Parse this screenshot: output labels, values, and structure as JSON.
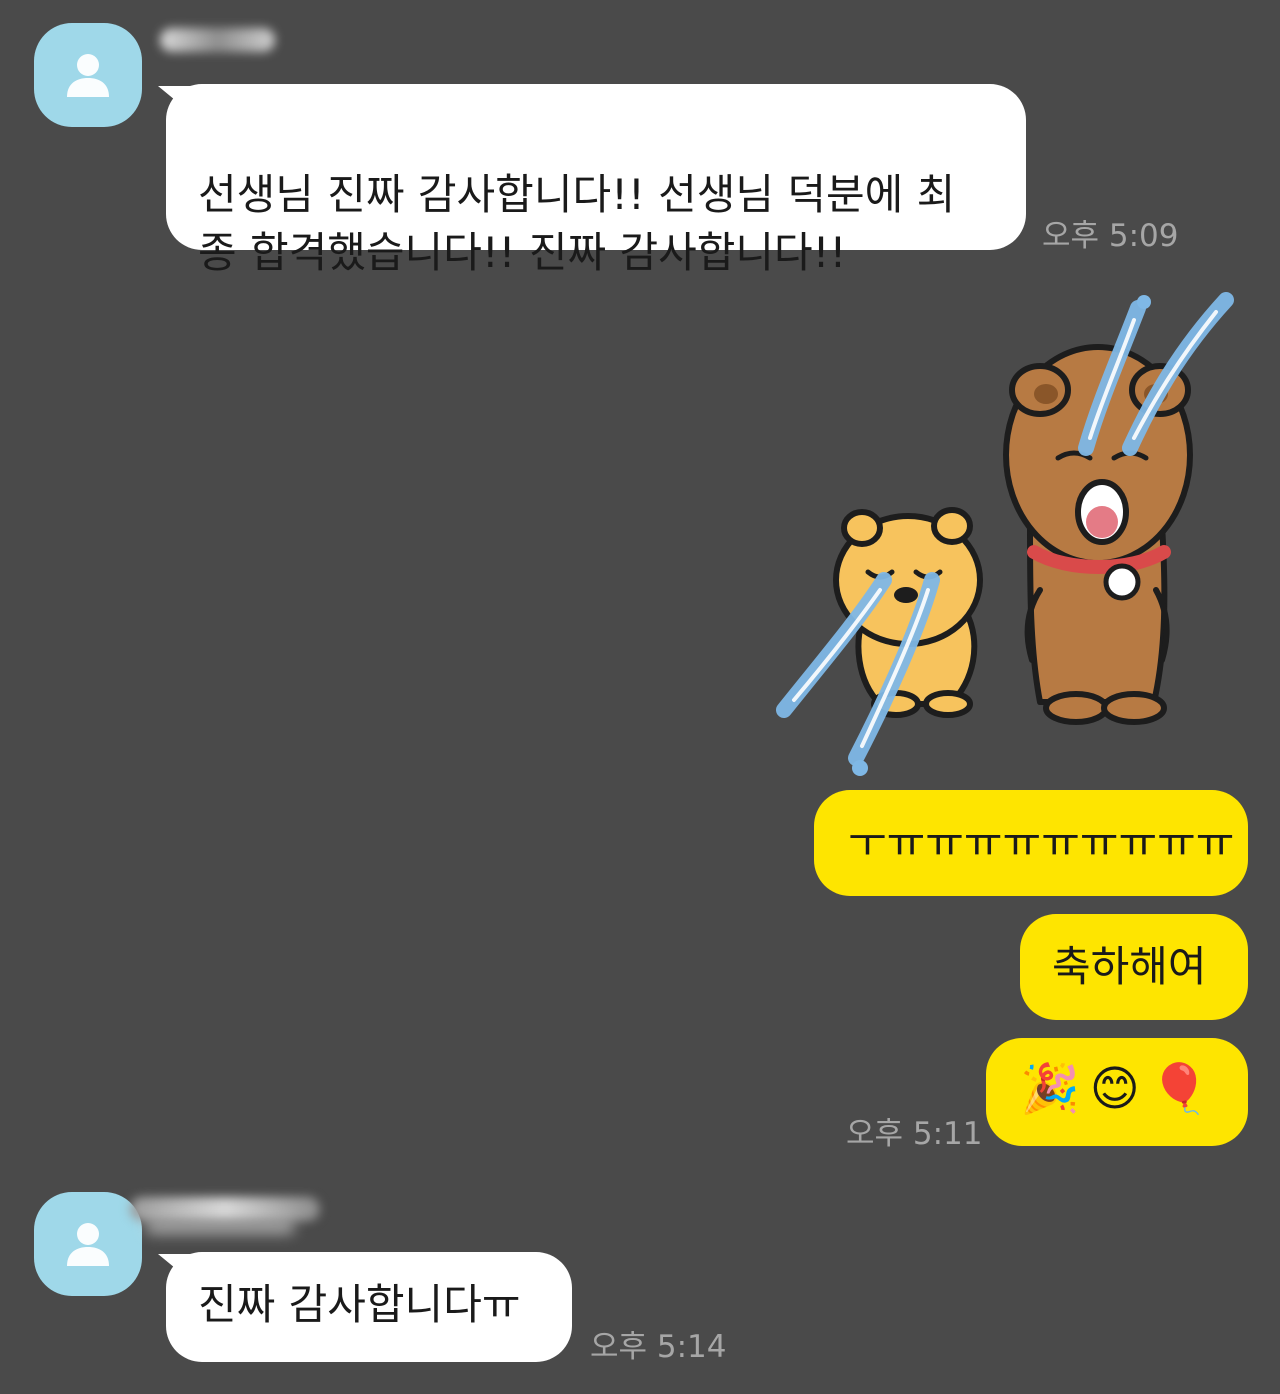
{
  "messages": [
    {
      "side": "incoming",
      "text": "선생님 진짜 감사합니다!! 선생님 덕분에 최\n종 합격했습니다!! 진짜 감사합니다!!",
      "time": "오후 5:09"
    },
    {
      "side": "outgoing",
      "type": "sticker",
      "sticker": "crying-bears-sticker"
    },
    {
      "side": "outgoing",
      "text": "ㅜㅠㅠㅠㅠㅠㅠㅠㅠㅠ"
    },
    {
      "side": "outgoing",
      "text": "축하해여"
    },
    {
      "side": "outgoing",
      "text": "🎉😊🎈",
      "time": "오후 5:11",
      "icons": [
        "party-popper-icon",
        "smiling-face-icon",
        "balloon-icon"
      ]
    },
    {
      "side": "incoming",
      "text": "진짜 감사합니다ㅠ",
      "time": "오후 5:14"
    }
  ],
  "colors": {
    "background": "#4a4a4a",
    "incoming_bubble": "#ffffff",
    "outgoing_bubble": "#fee500",
    "avatar": "#9fd8e9",
    "timestamp": "#a6a6a6"
  }
}
